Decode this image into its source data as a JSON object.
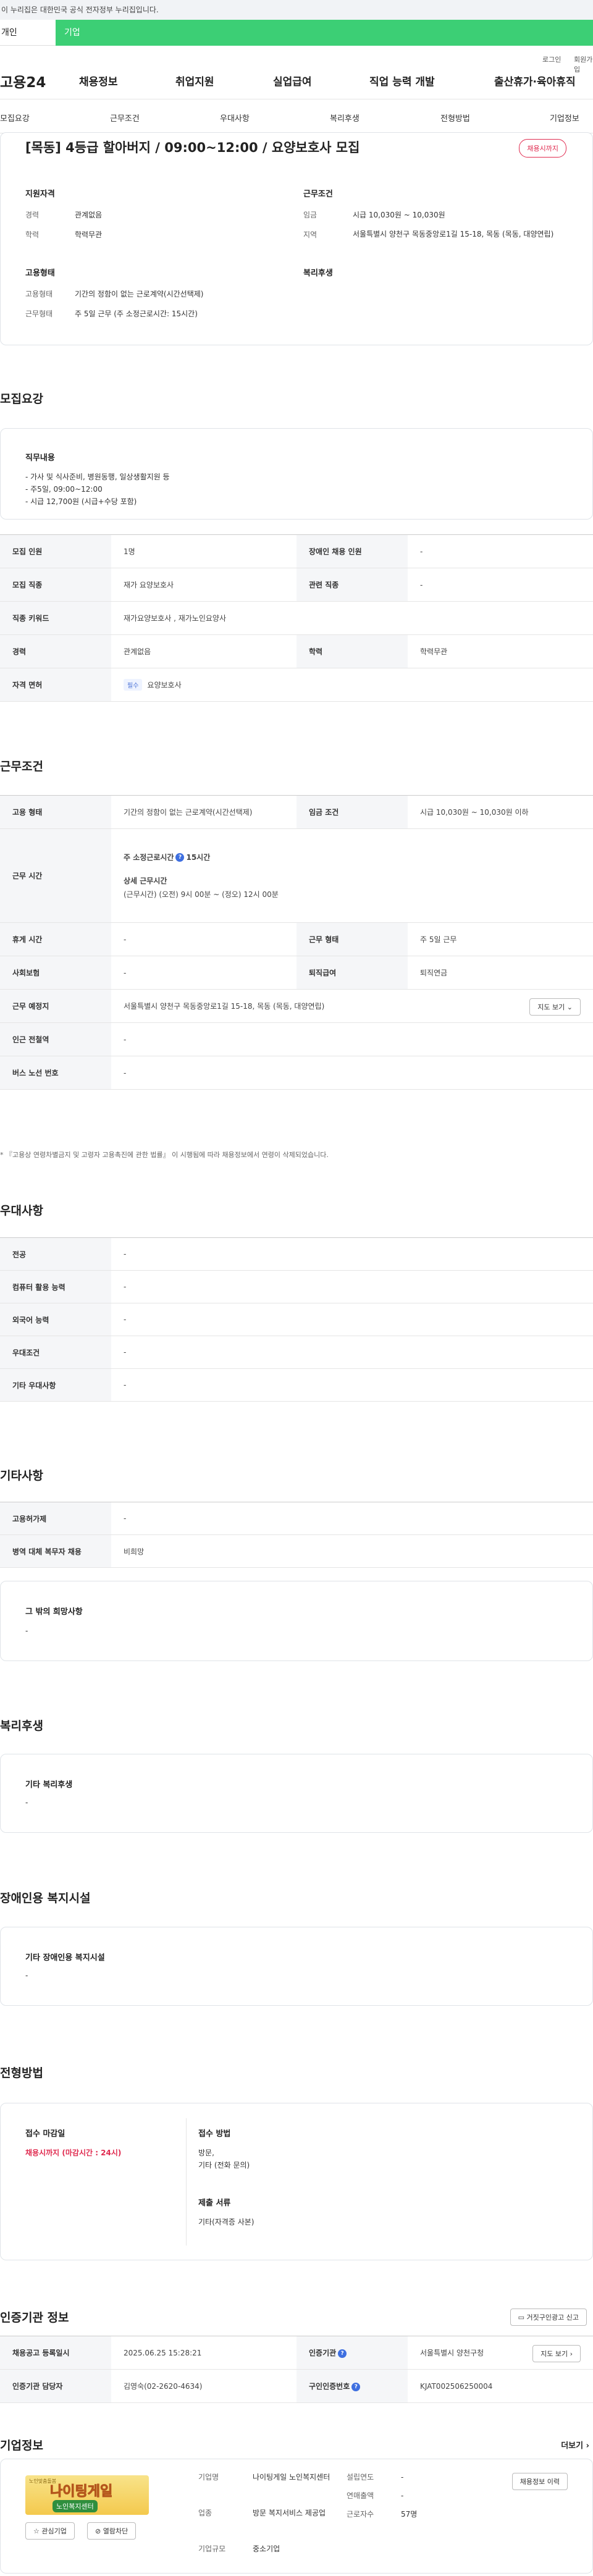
{
  "gov_bar": "이 누리집은 대한민국 공식 전자정부 누리집입니다.",
  "top_tabs": [
    "개인",
    "기업"
  ],
  "util": [
    "로그인",
    "회원가입"
  ],
  "gnb": {
    "logo": "고용24",
    "menu": [
      "채용정보",
      "취업지원",
      "실업급여",
      "직업 능력 개발",
      "출산휴가·육아휴직"
    ]
  },
  "lnb": [
    "모집요강",
    "근무조건",
    "우대사항",
    "복리후생",
    "전형방법",
    "기업정보"
  ],
  "summary": {
    "title": "[목동] 4등급 할아버지 / 09:00~12:00 / 요양보호사 모집",
    "badge": "채용시까지",
    "qual_title": "지원자격",
    "qual": [
      {
        "k": "경력",
        "v": "관계없음"
      },
      {
        "k": "학력",
        "v": "학력무관"
      }
    ],
    "work_title": "근무조건",
    "work": [
      {
        "k": "임금",
        "v": "시급 10,030원 ~ 10,030원"
      },
      {
        "k": "지역",
        "v": "서울특별시 양천구 목동중앙로1길 15-18, 목동 (목동, 대양연립)"
      }
    ],
    "emp_title": "고용형태",
    "emp": [
      {
        "k": "고용형태",
        "v": "기간의 정함이 없는 근로계약(시간선택제)"
      },
      {
        "k": "근무형태",
        "v": "주 5일 근무 (주 소정근로시간: 15시간)"
      }
    ],
    "welfare_title": "복리후생"
  },
  "recruit": {
    "title": "모집요강",
    "duty_label": "직무내용",
    "duty_lines": [
      "- 가사 및 식사준비, 병원동행, 일상생활지원 등",
      "- 주5일, 09:00~12:00",
      "- 시급 12,700원 (시급+수당 포함)"
    ],
    "rows": [
      {
        "h1": "모집 인원",
        "d1": "1명",
        "h2": "장애인 채용 인원",
        "d2": "-"
      },
      {
        "h1": "모집 직종",
        "d1": "재가 요양보호사",
        "h2": "관련 직종",
        "d2": "-"
      },
      {
        "h1": "직종 키워드",
        "d1": "재가요양보호사 , 재가노인요양사"
      },
      {
        "h1": "경력",
        "d1": "관계없음",
        "h2": "학력",
        "d2": "학력무관"
      },
      {
        "h1": "자격 면허",
        "badge": "필수",
        "d1": "요양보호사"
      }
    ]
  },
  "conditions": {
    "title": "근무조건",
    "row1": {
      "h1": "고용 형태",
      "d1": "기간의 정함이 없는 근로계약(시간선택제)",
      "h2": "임금 조건",
      "d2": "시급 10,030원 ~ 10,030원 이하"
    },
    "hours_h": "근무 시간",
    "hours_a": "주 소정근로시간",
    "hours_a_val": "15시간",
    "hours_b": "상세 근무시간",
    "hours_b_val": "(근무시간) (오전) 9시 00분 ~ (정오) 12시 00분",
    "row3": {
      "h1": "휴게 시간",
      "d1": "-",
      "h2": "근무 형태",
      "d2": "주 5일 근무"
    },
    "row4": {
      "h1": "사회보험",
      "d1": "-",
      "h2": "퇴직급여",
      "d2": "퇴직연금"
    },
    "row5": {
      "h1": "근무 예정지",
      "d1": "서울특별시 양천구 목동중앙로1길 15-18, 목동 (목동, 대양연립)",
      "btn": "지도 보기"
    },
    "row6": {
      "h1": "인근 전철역",
      "d1": "-"
    },
    "row7": {
      "h1": "버스 노선 번호",
      "d1": "-"
    },
    "note": "* 『고용상 연령차별금지 및 고령자 고용촉진에 관한 법률』 이 시행됨에 따라 채용정보에서 연령이 삭제되었습니다."
  },
  "preferred": {
    "title": "우대사항",
    "rows": [
      {
        "h": "전공",
        "d": "-"
      },
      {
        "h": "컴퓨터 활용 능력",
        "d": "-"
      },
      {
        "h": "외국어 능력",
        "d": "-"
      },
      {
        "h": "우대조건",
        "d": "-"
      },
      {
        "h": "기타 우대사항",
        "d": "-"
      }
    ]
  },
  "etc": {
    "title": "기타사항",
    "rows": [
      {
        "h": "고용허가제",
        "d": "-"
      },
      {
        "h": "병역 대체 복무자 채용",
        "d": "비희망"
      }
    ],
    "other_label": "그 밖의 희망사항",
    "other_val": "-"
  },
  "benefits": {
    "title": "복리후생",
    "label": "기타 복리후생",
    "val": "-"
  },
  "disabled": {
    "title": "장애인용 복지시설",
    "label": "기타 장애인용 복지시설",
    "val": "-"
  },
  "selection": {
    "title": "전형방법",
    "deadline_label": "접수 마감일",
    "deadline_val": "채용시까지 (마감시간 : 24시)",
    "method_label": "접수 방법",
    "method_lines": [
      "방문,",
      "기타 (전화 문의)"
    ],
    "docs_label": "제출 서류",
    "docs_val": "기타(자격증 사본)"
  },
  "agency": {
    "title": "인증기관 정보",
    "report_btn": "거짓구인광고 신고",
    "rows": [
      {
        "h1": "채용공고 등록일시",
        "d1": "2025.06.25 15:28:21",
        "h2": "인증기관",
        "d2": "서울특별시 양천구청",
        "btn": "지도 보기"
      },
      {
        "h1": "인증기관 담당자",
        "d1": "김영숙(02-2620-4634)",
        "h2": "구인인증번호",
        "d2": "KJAT002506250004"
      }
    ]
  },
  "company": {
    "title": "기업정보",
    "more": "더보기",
    "logo_top": "노인맞춤돌봄",
    "logo_main": "나이팅게일",
    "logo_sub": "노인복지센터",
    "fav_btn": "관심기업",
    "block_btn": "열람차단",
    "fields": [
      {
        "k": "기업명",
        "v": "나이팅게일 노인복지센터"
      },
      {
        "k": "업종",
        "v": "방문 복지서비스 제공업"
      },
      {
        "k": "기업규모",
        "v": "중소기업"
      }
    ],
    "fields2": [
      {
        "k": "설립연도",
        "v": "-"
      },
      {
        "k": "연매출액",
        "v": "-"
      },
      {
        "k": "근로자수",
        "v": "57명"
      }
    ],
    "history_btn": "채용정보 이력"
  }
}
